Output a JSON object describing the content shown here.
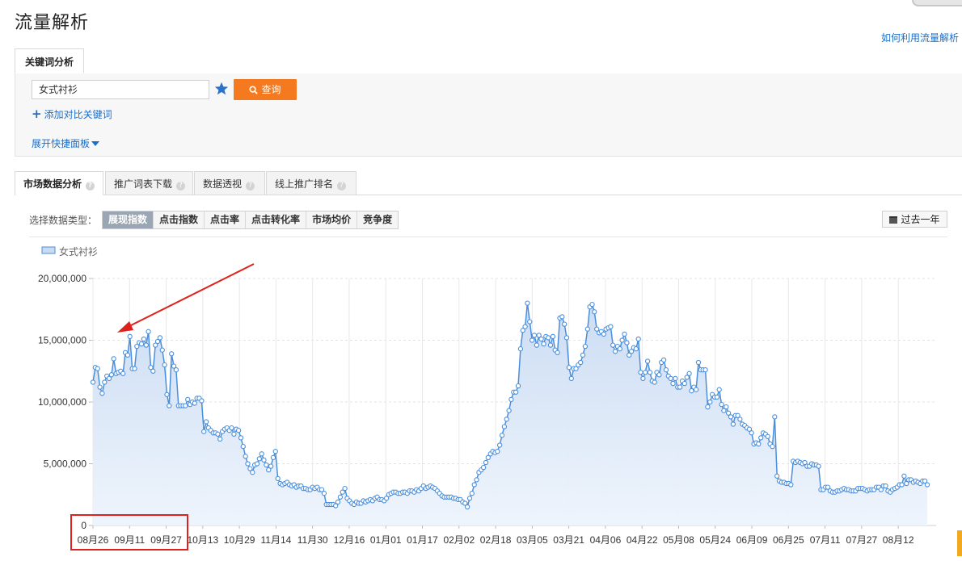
{
  "page": {
    "title": "流量解析",
    "help_link": "如何利用流量解析"
  },
  "keyword_panel": {
    "tab_label": "关键词分析",
    "keyword_value": "女式衬衫",
    "query_label": "查询",
    "add_compare_label": "添加对比关键词",
    "expand_label": "展开快捷面板"
  },
  "sub_tabs": [
    {
      "label": "市场数据分析",
      "active": true
    },
    {
      "label": "推广词表下载",
      "active": false
    },
    {
      "label": "数据透视",
      "active": false
    },
    {
      "label": "线上推广排名",
      "active": false
    }
  ],
  "data_type": {
    "label": "选择数据类型：",
    "options": [
      "展现指数",
      "点击指数",
      "点击率",
      "点击转化率",
      "市场均价",
      "竞争度"
    ],
    "selected": "展现指数",
    "range_label": "过去一年"
  },
  "colors": {
    "accent_orange": "#f57a1f",
    "link_blue": "#1a6fc9",
    "line_blue": "#4a8fdd",
    "annotation_red": "#e0201c"
  },
  "chart_data": {
    "type": "area",
    "legend": [
      "女式衬衫"
    ],
    "legend_position": "top-left",
    "grid": true,
    "ylim": [
      0,
      20000000
    ],
    "yticks": [
      "0",
      "5,000,000",
      "10,000,000",
      "15,000,000",
      "20,000,000"
    ],
    "x_tick_labels": [
      "08月26",
      "09月11",
      "09月27",
      "10月13",
      "10月29",
      "11月14",
      "11月30",
      "12月16",
      "01月01",
      "01月17",
      "02月02",
      "02月18",
      "03月05",
      "03月21",
      "04月06",
      "04月22",
      "05月08",
      "05月24",
      "06月09",
      "06月25",
      "07月11",
      "07月27",
      "08月12"
    ],
    "series": [
      {
        "name": "女式衬衫",
        "daily_values": [
          11600000,
          12800000,
          12700000,
          11200000,
          10700000,
          11600000,
          12100000,
          11900000,
          12200000,
          13500000,
          12300000,
          12400000,
          12500000,
          12300000,
          14000000,
          13800000,
          15300000,
          12700000,
          12700000,
          14500000,
          14800000,
          14700000,
          15100000,
          14600000,
          15700000,
          12800000,
          12500000,
          14600000,
          14900000,
          15200000,
          14200000,
          13000000,
          10600000,
          9700000,
          13900000,
          12900000,
          12600000,
          9700000,
          9700000,
          9700000,
          9700000,
          10200000,
          9800000,
          10000000,
          9900000,
          10300000,
          10300000,
          10100000,
          7600000,
          8400000,
          7900000,
          7700000,
          7500000,
          7500000,
          7400000,
          7000000,
          7600000,
          7800000,
          7900000,
          7700000,
          7900000,
          7400000,
          7800000,
          7700000,
          7100000,
          6400000,
          5600000,
          5000000,
          4600000,
          4300000,
          4900000,
          5000000,
          5400000,
          5800000,
          5300000,
          4900000,
          4500000,
          4800000,
          5500000,
          6000000,
          3800000,
          3400000,
          3300000,
          3400000,
          3500000,
          3300000,
          3200000,
          3300000,
          3100000,
          3200000,
          3200000,
          3000000,
          3000000,
          2900000,
          2900000,
          3100000,
          3000000,
          3100000,
          2900000,
          2900000,
          2600000,
          1700000,
          1700000,
          1700000,
          1700000,
          1600000,
          1900000,
          2300000,
          2700000,
          3000000,
          2200000,
          2000000,
          1800000,
          1700000,
          1900000,
          1800000,
          1800000,
          2000000,
          1900000,
          2000000,
          2100000,
          2000000,
          2200000,
          2300000,
          2100000,
          2100000,
          2000000,
          2200000,
          2500000,
          2600000,
          2700000,
          2700000,
          2600000,
          2600000,
          2700000,
          2700000,
          2600000,
          2800000,
          2800000,
          2700000,
          2900000,
          2800000,
          3000000,
          3200000,
          3000000,
          3100000,
          3200000,
          3100000,
          3000000,
          2800000,
          2600000,
          2400000,
          2300000,
          2300000,
          2300000,
          2300000,
          2200000,
          2200000,
          2100000,
          2100000,
          1900000,
          1800000,
          1500000,
          2200000,
          2600000,
          3300000,
          3700000,
          4300000,
          4500000,
          4700000,
          5100000,
          5500000,
          5800000,
          6000000,
          5900000,
          6000000,
          6500000,
          7300000,
          8000000,
          8600000,
          9300000,
          10200000,
          10800000,
          10800000,
          11300000,
          14300000,
          15800000,
          16100000,
          18000000,
          16500000,
          15000000,
          15400000,
          14600000,
          15400000,
          15100000,
          14700000,
          15300000,
          15200000,
          14600000,
          15300000,
          14200000,
          14000000,
          16800000,
          16900000,
          16300000,
          15200000,
          12800000,
          11900000,
          12700000,
          12700000,
          13000000,
          13200000,
          13800000,
          14500000,
          15900000,
          17700000,
          17900000,
          17300000,
          15900000,
          15600000,
          15700000,
          15500000,
          15900000,
          16000000,
          16100000,
          14600000,
          14100000,
          14500000,
          14300000,
          15000000,
          15500000,
          14800000,
          13800000,
          14100000,
          14400000,
          14300000,
          15100000,
          12400000,
          11900000,
          12400000,
          13300000,
          12400000,
          11700000,
          11600000,
          12400000,
          12200000,
          13200000,
          13400000,
          12600000,
          12100000,
          11900000,
          11500000,
          11900000,
          11200000,
          11200000,
          11700000,
          11500000,
          12000000,
          12300000,
          10900000,
          11200000,
          11000000,
          13200000,
          12600000,
          12600000,
          12600000,
          9600000,
          10000000,
          10600000,
          10400000,
          10400000,
          11000000,
          9800000,
          9300000,
          9600000,
          9100000,
          8800000,
          8200000,
          8900000,
          8900000,
          8600000,
          8200000,
          8100000,
          7900000,
          7800000,
          7500000,
          6600000,
          6700000,
          6600000,
          7100000,
          7500000,
          7400000,
          7200000,
          6600000,
          6400000,
          8800000,
          4000000,
          3600000,
          3500000,
          3500000,
          3400000,
          3400000,
          3300000,
          5200000,
          5100000,
          5200000,
          5100000,
          5000000,
          5100000,
          4800000,
          4800000,
          5000000,
          4900000,
          4900000,
          4800000,
          2900000,
          2900000,
          3100000,
          3100000,
          2800000,
          2700000,
          2700000,
          2800000,
          2800000,
          2900000,
          3000000,
          2900000,
          2900000,
          2800000,
          2800000,
          2800000,
          3000000,
          3000000,
          3000000,
          2900000,
          2800000,
          2900000,
          2900000,
          2900000,
          3100000,
          3100000,
          2900000,
          3200000,
          3200000,
          2800000,
          2700000,
          2900000,
          3000000,
          3100000,
          3300000,
          3300000,
          4000000,
          3400000,
          3700000,
          3700000,
          3500000,
          3600000,
          3500000,
          3400000,
          3600000,
          3600000,
          3300000
        ]
      }
    ]
  }
}
